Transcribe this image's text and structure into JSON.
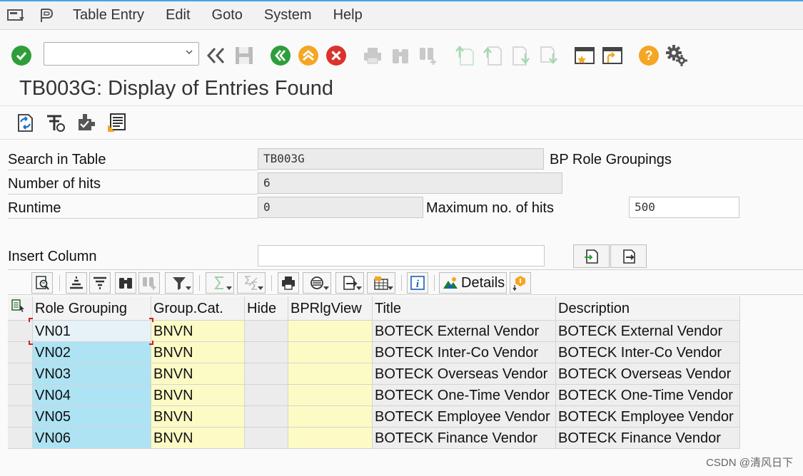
{
  "menubar": {
    "items": [
      {
        "label": "Table Entry"
      },
      {
        "label": "Edit"
      },
      {
        "label": "Goto"
      },
      {
        "label": "System"
      },
      {
        "label": "Help"
      }
    ]
  },
  "toolbar": {
    "command_field_value": ""
  },
  "page_title": "TB003G: Display of Entries Found",
  "form": {
    "search_in_table_label": "Search in Table",
    "search_in_table_value": "TB003G",
    "table_description": "BP Role Groupings",
    "number_of_hits_label": "Number of hits",
    "number_of_hits_value": "6",
    "runtime_label": "Runtime",
    "runtime_value": "0",
    "max_hits_label": "Maximum no. of hits",
    "max_hits_value": "500",
    "insert_column_label": "Insert Column",
    "insert_column_value": ""
  },
  "alv_toolbar": {
    "details_label": "Details"
  },
  "grid": {
    "columns": [
      "Role Grouping",
      "Group.Cat.",
      "Hide",
      "BPRlgView",
      "Title",
      "Description"
    ],
    "rows": [
      [
        "VN01",
        "BNVN",
        "",
        "",
        "BOTECK External Vendor",
        "BOTECK External Vendor"
      ],
      [
        "VN02",
        "BNVN",
        "",
        "",
        "BOTECK Inter-Co Vendor",
        "BOTECK Inter-Co Vendor"
      ],
      [
        "VN03",
        "BNVN",
        "",
        "",
        "BOTECK Overseas Vendor",
        "BOTECK Overseas Vendor"
      ],
      [
        "VN04",
        "BNVN",
        "",
        "",
        "BOTECK One-Time Vendor",
        "BOTECK One-Time Vendor"
      ],
      [
        "VN05",
        "BNVN",
        "",
        "",
        "BOTECK Employee Vendor",
        "BOTECK Employee Vendor"
      ],
      [
        "VN06",
        "BNVN",
        "",
        "",
        "BOTECK Finance Vendor",
        "BOTECK Finance Vendor"
      ]
    ]
  },
  "watermark": "CSDN @清风日下",
  "colors": {
    "key_column": "#aee3f4",
    "yellow_column": "#fdfbc5",
    "ok_green": "#2e9e3a",
    "back_green": "#2e9e3a",
    "up_orange": "#f5a623",
    "cancel_red": "#d9342b",
    "help_orange": "#f5a623"
  },
  "icons": {
    "menu": "sap-menu-icon",
    "enter": "enter-check-icon",
    "save": "save-icon",
    "back": "back-icon",
    "exit": "exit-icon",
    "cancel": "cancel-icon",
    "print": "print-icon",
    "find": "find-icon",
    "find_next": "find-next-icon",
    "first_page": "first-page-icon",
    "prev_page": "previous-page-icon",
    "next_page": "next-page-icon",
    "last_page": "last-page-icon",
    "new_session": "new-session-icon",
    "shortcut": "create-shortcut-icon",
    "help": "help-icon",
    "settings": "customize-layout-icon"
  }
}
